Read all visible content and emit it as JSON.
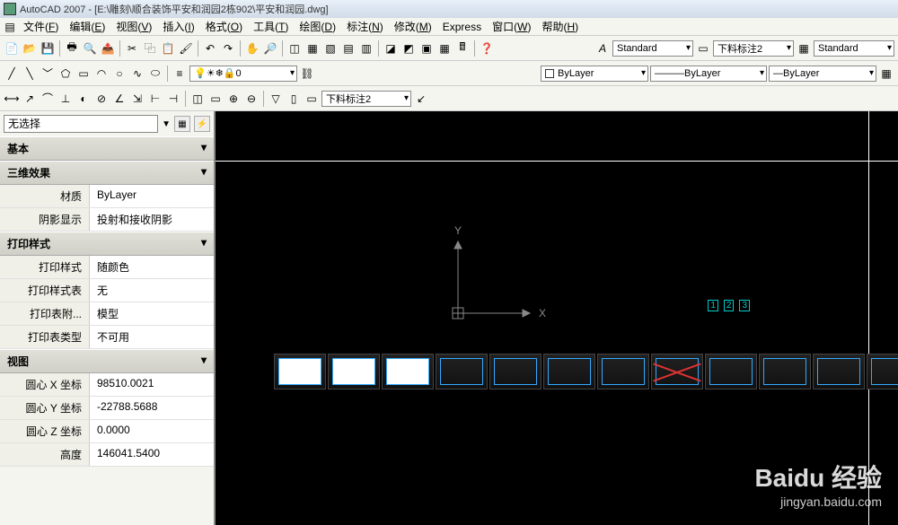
{
  "title": "AutoCAD 2007 - [E:\\雕刻\\顺合装饰平安和润园2栋902\\平安和润园.dwg]",
  "menus": [
    "文件(F)",
    "编辑(E)",
    "视图(V)",
    "插入(I)",
    "格式(O)",
    "工具(T)",
    "绘图(D)",
    "标注(N)",
    "修改(M)",
    "Express",
    "窗口(W)",
    "帮助(H)"
  ],
  "row1_combos": {
    "style1": "Standard",
    "dim": "下料标注2",
    "style2": "Standard"
  },
  "row2_combos": {
    "layer": "0",
    "c1": "ByLayer",
    "c2": "ByLayer",
    "c3": "ByLayer"
  },
  "row3_combo": "下料标注2",
  "sidebar": {
    "selection": "无选择",
    "sections": [
      {
        "title": "基本",
        "rows": []
      },
      {
        "title": "三维效果",
        "rows": [
          {
            "k": "材质",
            "v": "ByLayer"
          },
          {
            "k": "阴影显示",
            "v": "投射和接收阴影"
          }
        ]
      },
      {
        "title": "打印样式",
        "rows": [
          {
            "k": "打印样式",
            "v": "随颜色"
          },
          {
            "k": "打印样式表",
            "v": "无"
          },
          {
            "k": "打印表附...",
            "v": "模型"
          },
          {
            "k": "打印表类型",
            "v": "不可用"
          }
        ]
      },
      {
        "title": "视图",
        "rows": [
          {
            "k": "圆心 X 坐标",
            "v": "98510.0021"
          },
          {
            "k": "圆心 Y 坐标",
            "v": "-22788.5688"
          },
          {
            "k": "圆心 Z 坐标",
            "v": "0.0000"
          },
          {
            "k": "高度",
            "v": "146041.5400"
          }
        ]
      }
    ]
  },
  "ucs": {
    "x": "X",
    "y": "Y"
  },
  "watermark": {
    "logo": "Baidu 经验",
    "sub": "jingyan.baidu.com"
  },
  "markers": [
    "1",
    "2",
    "3"
  ],
  "thumbs": [
    {
      "white": true
    },
    {
      "white": true
    },
    {
      "white": true
    },
    {
      "white": false
    },
    {
      "white": false
    },
    {
      "white": false
    },
    {
      "white": false
    },
    {
      "white": false,
      "x": true
    },
    {
      "white": false
    },
    {
      "white": false
    },
    {
      "white": false
    },
    {
      "white": false
    }
  ]
}
